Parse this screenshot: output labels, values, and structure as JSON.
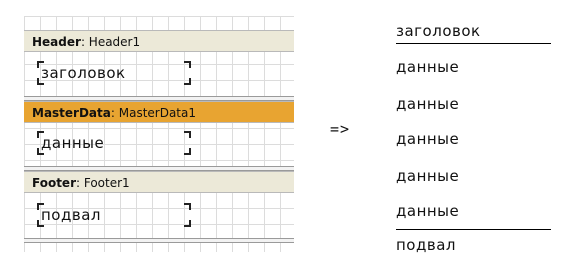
{
  "designer": {
    "header_band": {
      "type": "Header",
      "name": "Header1",
      "field": "заголовок"
    },
    "masterdata_band": {
      "type": "MasterData",
      "name": "MasterData1",
      "field": "данные"
    },
    "footer_band": {
      "type": "Footer",
      "name": "Footer1",
      "field": "подвал"
    }
  },
  "arrow_label": "=>",
  "preview": {
    "title": "заголовок",
    "rows": [
      "данные",
      "данные",
      "данные",
      "данные",
      "данные"
    ],
    "footer": "подвал"
  },
  "colors": {
    "band_gray": "#ece9d8",
    "band_selected": "#e8a431",
    "grid": "#dcdcdc"
  }
}
